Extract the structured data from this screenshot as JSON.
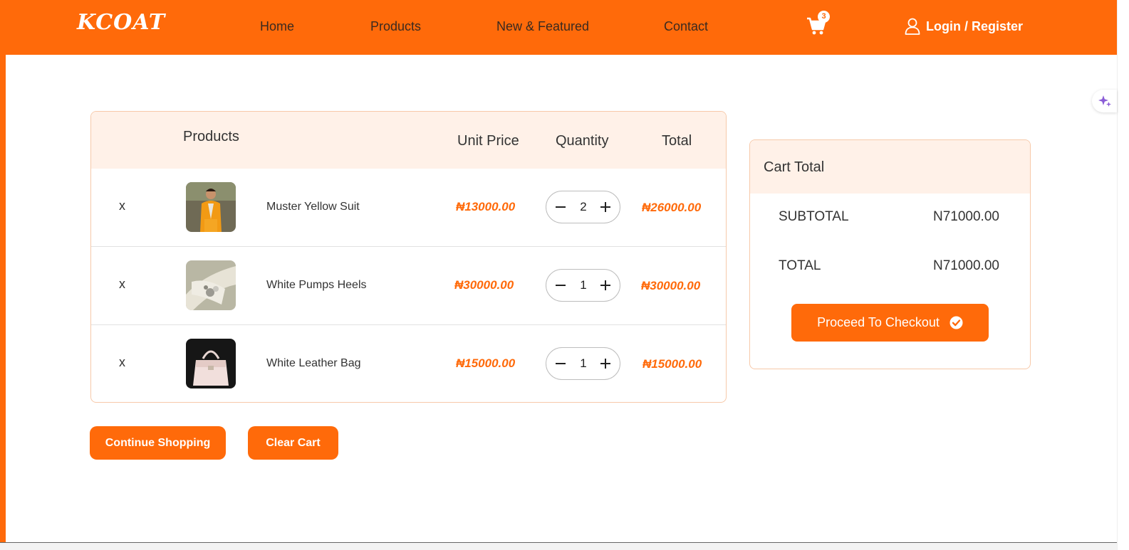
{
  "brand": {
    "logo": "KCOAT",
    "accent": "#ff6a0a",
    "header_tint": "#fff1e8"
  },
  "nav": {
    "links": [
      "Home",
      "Products",
      "New & Featured",
      "Contact"
    ],
    "cart_count": "3",
    "login_label": "Login / Register",
    "icons": {
      "cart": "cart-icon",
      "user": "user-icon"
    }
  },
  "cart": {
    "headers": {
      "products": "Products",
      "unit_price": "Unit Price",
      "quantity": "Quantity",
      "total": "Total"
    },
    "items": [
      {
        "remove": "x",
        "name": "Muster Yellow Suit",
        "unit_price": "₦13000.00",
        "quantity": "2",
        "total": "₦26000.00"
      },
      {
        "remove": "x",
        "name": "White Pumps Heels",
        "unit_price": "₦30000.00",
        "quantity": "1",
        "total": "₦30000.00"
      },
      {
        "remove": "x",
        "name": "White Leather Bag",
        "unit_price": "₦15000.00",
        "quantity": "1",
        "total": "₦15000.00"
      }
    ],
    "continue_label": "Continue Shopping",
    "clear_label": "Clear Cart"
  },
  "summary": {
    "title": "Cart Total",
    "subtotal_label": "SUBTOTAL",
    "subtotal_value": "N71000.00",
    "total_label": "TOTAL",
    "total_value": "N71000.00",
    "checkout_label": "Proceed To Checkout"
  }
}
